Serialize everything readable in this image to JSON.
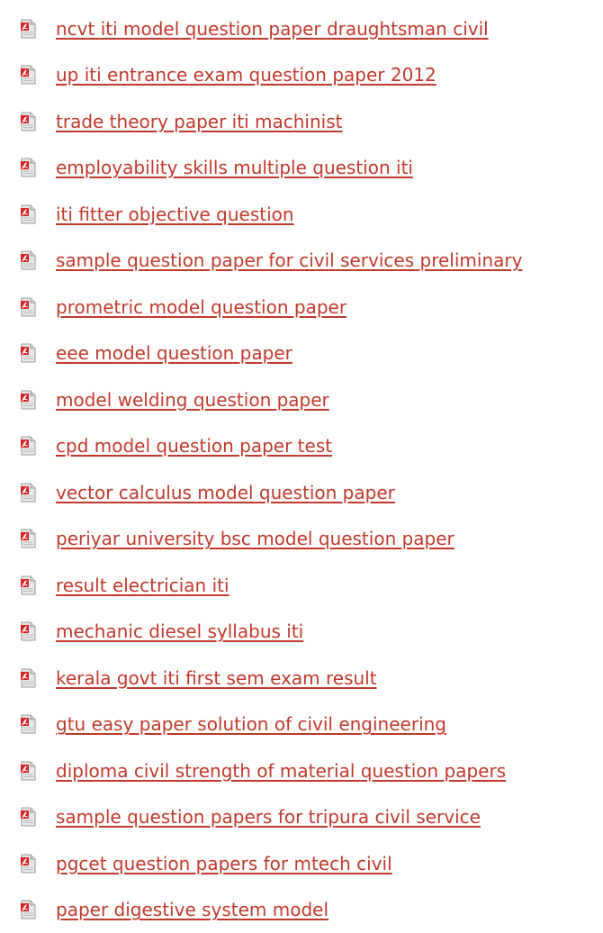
{
  "theme": {
    "link_color": "#c0392b",
    "icon_color": "#d62222"
  },
  "documents": [
    {
      "title": "ncvt iti model question paper draughtsman civil",
      "icon": "pdf-icon"
    },
    {
      "title": "up iti entrance exam question paper 2012",
      "icon": "pdf-icon"
    },
    {
      "title": "trade theory paper iti machinist",
      "icon": "pdf-icon"
    },
    {
      "title": "employability skills multiple question iti",
      "icon": "pdf-icon"
    },
    {
      "title": "iti fitter objective question",
      "icon": "pdf-icon"
    },
    {
      "title": "sample question paper for civil services preliminary",
      "icon": "pdf-icon"
    },
    {
      "title": "prometric model question paper",
      "icon": "pdf-icon"
    },
    {
      "title": "eee model question paper",
      "icon": "pdf-icon"
    },
    {
      "title": "model welding question paper",
      "icon": "pdf-icon"
    },
    {
      "title": "cpd model question paper test",
      "icon": "pdf-icon"
    },
    {
      "title": "vector calculus model question paper",
      "icon": "pdf-icon"
    },
    {
      "title": "periyar university bsc model question paper",
      "icon": "pdf-icon"
    },
    {
      "title": "result electrician iti",
      "icon": "pdf-icon"
    },
    {
      "title": "mechanic diesel syllabus iti",
      "icon": "pdf-icon"
    },
    {
      "title": "kerala govt iti first sem exam result",
      "icon": "pdf-icon"
    },
    {
      "title": "gtu easy paper solution of civil engineering",
      "icon": "pdf-icon"
    },
    {
      "title": "diploma civil strength of material question papers",
      "icon": "pdf-icon"
    },
    {
      "title": "sample question papers for tripura civil service",
      "icon": "pdf-icon"
    },
    {
      "title": "pgcet question papers for mtech civil",
      "icon": "pdf-icon"
    },
    {
      "title": "paper digestive system model",
      "icon": "pdf-icon"
    }
  ]
}
